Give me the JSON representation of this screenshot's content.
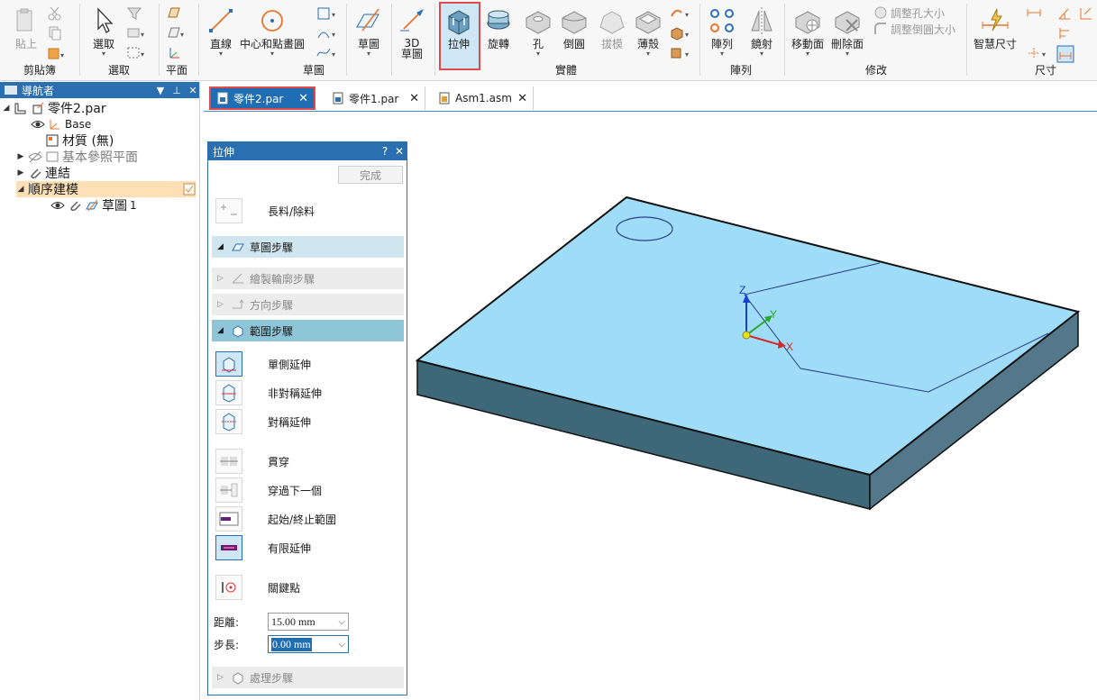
{
  "ribbon": {
    "clipboard": {
      "paste": "貼上",
      "group": "剪貼簿"
    },
    "select": {
      "select": "選取",
      "group": "選取"
    },
    "plane": {
      "group": "平面"
    },
    "sketch": {
      "line": "直線",
      "circle": "中心和點畫圓",
      "sketch": "草圖",
      "group": "草圖",
      "sketch3d": "3D\n草圖"
    },
    "solids": {
      "extrude": "拉伸",
      "revolve": "旋轉",
      "hole": "孔",
      "round": "倒圓",
      "draft": "拔模",
      "thin": "薄殼",
      "group": "實體"
    },
    "pattern": {
      "pattern": "陣列",
      "mirror": "鏡射",
      "group": "陣列"
    },
    "modify": {
      "move_face": "移動面",
      "delete_face": "刪除面",
      "resize_hole": "調整孔大小",
      "resize_round": "調整倒圓大小",
      "group": "修改"
    },
    "dimension": {
      "smart": "智慧尺寸",
      "group": "尺寸"
    }
  },
  "navigator": {
    "title": "導航者",
    "part": "零件2.par",
    "base": "Base",
    "material": "材質 (無)",
    "ref_planes": "基本參照平面",
    "links": "連結",
    "ordered": "順序建模",
    "sketch": "草圖",
    "sketch_num": "1"
  },
  "tabs": [
    {
      "label": "零件2.par"
    },
    {
      "label": "零件1.par"
    },
    {
      "label": "Asm1.asm"
    }
  ],
  "panel": {
    "title": "拉伸",
    "help": "?",
    "finish": "完成",
    "add_remove": "長料/除料",
    "steps": {
      "sketch": "草圖步驟",
      "draw_profile": "繪製輪廓步驟",
      "direction": "方向步驟",
      "extent": "範圍步驟",
      "treatment": "處理步驟"
    },
    "options": {
      "single": "單側延伸",
      "asymmetric": "非對稱延伸",
      "symmetric": "對稱延伸",
      "through_all": "貫穿",
      "through_next": "穿過下一個",
      "from_to": "起始/終止範圍",
      "finite": "有限延伸",
      "keypoint": "關鍵點"
    },
    "distance_label": "距離:",
    "distance_value": "15.00 mm",
    "step_label": "步長:",
    "step_value": "0.00 mm"
  },
  "viewport": {
    "axis_x": "X",
    "axis_y": "Y",
    "axis_z": "Z",
    "colors": {
      "top": "#9fdcf8",
      "front": "#3e6878",
      "side": "#52788a"
    }
  }
}
